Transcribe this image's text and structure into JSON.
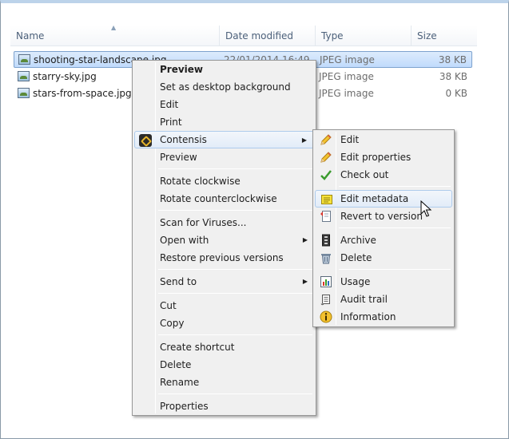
{
  "columns": {
    "name": "Name",
    "date": "Date modified",
    "type": "Type",
    "size": "Size"
  },
  "files": [
    {
      "name": "shooting-star-landscape.jpg",
      "date": "22/01/2014 16:49",
      "type": "JPEG image",
      "size": "38 KB",
      "selected": true
    },
    {
      "name": "starry-sky.jpg",
      "date": "",
      "type": "JPEG image",
      "size": "38 KB",
      "selected": false
    },
    {
      "name": "stars-from-space.jpg",
      "date": "",
      "type": "JPEG image",
      "size": "0 KB",
      "selected": false
    }
  ],
  "context_menu": {
    "items": [
      {
        "label": "Preview"
      },
      {
        "label": "Set as desktop background"
      },
      {
        "label": "Edit"
      },
      {
        "label": "Print"
      },
      {
        "label": "Contensis"
      },
      {
        "label": "Preview"
      },
      {
        "label": "Rotate clockwise"
      },
      {
        "label": "Rotate counterclockwise"
      },
      {
        "label": "Scan for Viruses..."
      },
      {
        "label": "Open with"
      },
      {
        "label": "Restore previous versions"
      },
      {
        "label": "Send to"
      },
      {
        "label": "Cut"
      },
      {
        "label": "Copy"
      },
      {
        "label": "Create shortcut"
      },
      {
        "label": "Delete"
      },
      {
        "label": "Rename"
      },
      {
        "label": "Properties"
      }
    ]
  },
  "submenu": {
    "items": [
      {
        "label": "Edit",
        "icon": "pencil-icon"
      },
      {
        "label": "Edit properties",
        "icon": "pencil-icon"
      },
      {
        "label": "Check out",
        "icon": "checkmark-icon"
      },
      {
        "label": "Edit metadata",
        "icon": "metadata-icon"
      },
      {
        "label": "Revert to version",
        "icon": "revert-icon"
      },
      {
        "label": "Archive",
        "icon": "archive-icon"
      },
      {
        "label": "Delete",
        "icon": "trash-icon"
      },
      {
        "label": "Usage",
        "icon": "usage-chart-icon"
      },
      {
        "label": "Audit trail",
        "icon": "scroll-icon"
      },
      {
        "label": "Information",
        "icon": "info-icon"
      }
    ]
  },
  "colors": {
    "selection": "#cce4fc",
    "menu_bg": "#f0f0f0",
    "header_text": "#4c607a"
  }
}
